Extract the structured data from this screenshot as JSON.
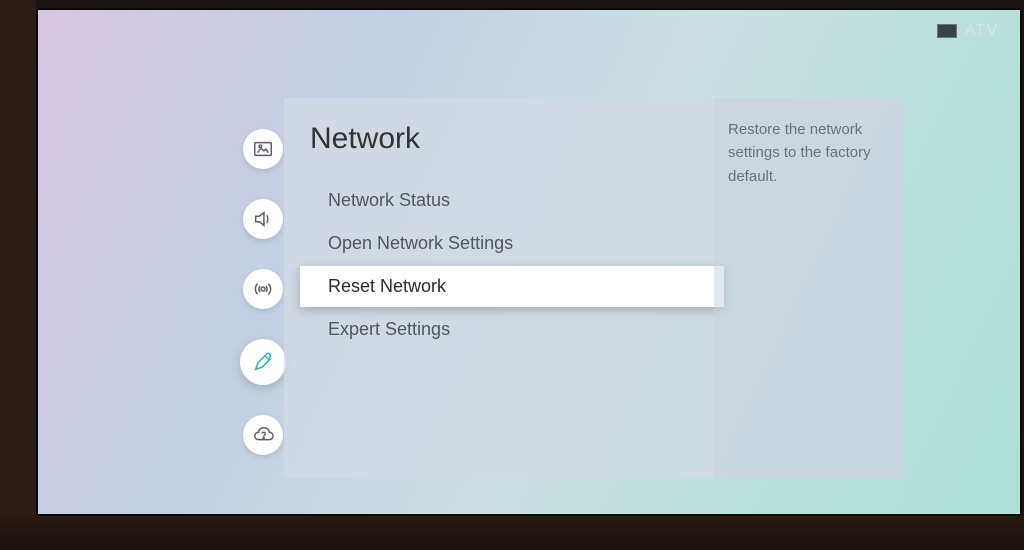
{
  "corner": {
    "source": "ATV"
  },
  "page": {
    "title": "Network"
  },
  "menu": {
    "items": [
      {
        "label": "Network Status",
        "selected": false
      },
      {
        "label": "Open Network Settings",
        "selected": false
      },
      {
        "label": "Reset Network",
        "selected": true
      },
      {
        "label": "Expert Settings",
        "selected": false
      }
    ]
  },
  "help": {
    "text": "Restore the network settings to the factory default."
  },
  "rail": {
    "items": [
      {
        "name": "picture-icon"
      },
      {
        "name": "sound-icon"
      },
      {
        "name": "broadcasting-icon"
      },
      {
        "name": "general-icon",
        "active": true
      },
      {
        "name": "support-icon"
      }
    ]
  }
}
